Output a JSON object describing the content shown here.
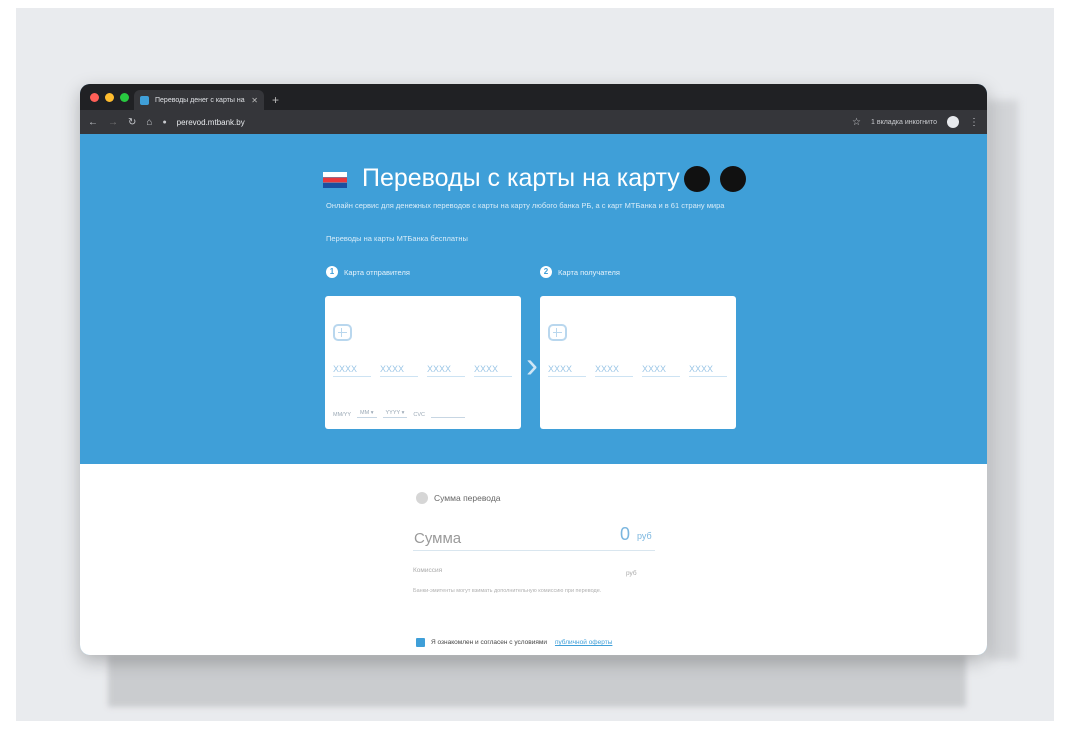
{
  "browser": {
    "tab_title": "Переводы денег с карты на к",
    "tab_close": "✕",
    "new_tab": "+",
    "url": "perevod.mtbank.by",
    "incognito_label": "1 вкладка инкогнито",
    "colors": {
      "chrome": "#202124",
      "toolbar": "#35363a"
    }
  },
  "site": {
    "title": "Переводы с карты на карту",
    "subtitle": "Онлайн сервис для денежных переводов с карты на карту любого банка РБ, а с карт МТБанка и в 61 страну мира",
    "free_note": "Переводы на карты МТБанка бесплатны",
    "stores": {
      "apple_icon": "apple-icon",
      "android_icon": "android-icon"
    },
    "colors": {
      "primary": "#3f9fd8",
      "logo_red": "#e8383d"
    }
  },
  "sender": {
    "step": "1",
    "label": "Карта отправителя",
    "card_placeholders": [
      "XXXX",
      "XXXX",
      "XXXX",
      "XXXX"
    ],
    "valid_label": "MM/YY",
    "month_placeholder": "MM",
    "year_placeholder": "YYYY",
    "cvc_label": "CVC"
  },
  "recipient": {
    "step": "2",
    "label": "Карта получателя",
    "card_placeholders": [
      "XXXX",
      "XXXX",
      "XXXX",
      "XXXX"
    ]
  },
  "transfer": {
    "step_label": "Сумма перевода",
    "amount_label": "Сумма",
    "amount_value": "0",
    "currency": "руб",
    "fee_label": "Комиссия",
    "fee_currency": "руб",
    "fee_note": "Банки-эмитенты могут взимать дополнительную комиссию при переводе.",
    "agree_text": "Я ознакомлен и согласен с условиями",
    "agree_link": "публичной оферты"
  }
}
